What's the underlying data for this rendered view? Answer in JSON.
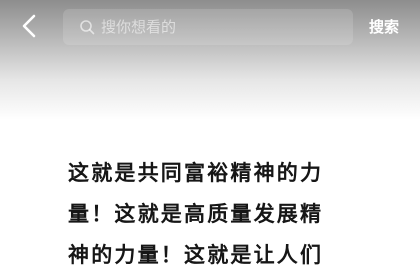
{
  "header": {
    "back_icon": "chevron-left-icon",
    "search": {
      "icon": "search-icon",
      "placeholder": "搜你想看的",
      "value": ""
    },
    "submit_label": "搜索"
  },
  "content": {
    "lines": [
      "这就是共同富裕精神的力",
      "量！这就是高质量发展精",
      "神的力量！这就是让人们"
    ]
  },
  "colors": {
    "header_gray": "#8d8d8d",
    "background": "#ffffff",
    "text": "#161616"
  }
}
